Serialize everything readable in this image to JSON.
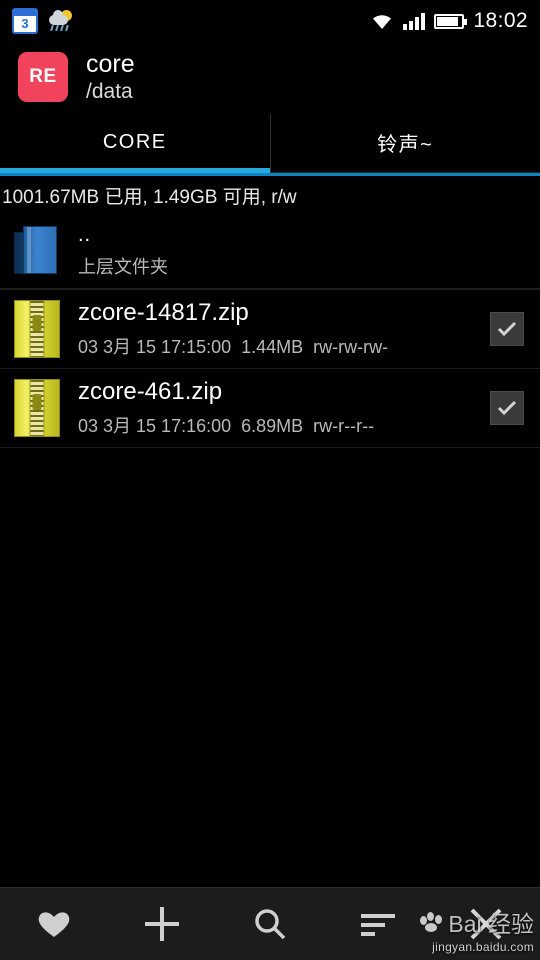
{
  "statusbar": {
    "calendar_day": "3",
    "clock": "18:02",
    "icons": {
      "calendar": "calendar-icon",
      "weather": "weather-partly-cloudy-rain-icon",
      "wifi": "wifi-icon",
      "signal": "cellular-signal-icon",
      "battery": "battery-icon"
    }
  },
  "appbar": {
    "icon_label": "RE",
    "title": "core",
    "path": "/data"
  },
  "tabs": [
    {
      "label": "CORE",
      "active": true
    },
    {
      "label": "铃声~",
      "active": false
    }
  ],
  "storage": {
    "text": "1001.67MB 已用, 1.49GB 可用, r/w"
  },
  "files": [
    {
      "name": "..",
      "sub": "上层文件夹",
      "icon": "folder-up-icon",
      "checkbox": false,
      "checked": false
    },
    {
      "name": "zcore-14817.zip",
      "date": "03 3月 15 17:15:00",
      "size": "1.44MB",
      "perms": "rw-rw-rw-",
      "icon": "zip-file-icon",
      "checkbox": true,
      "checked": true
    },
    {
      "name": "zcore-461.zip",
      "date": "03 3月 15 17:16:00",
      "size": "6.89MB",
      "perms": "rw-r--r--",
      "icon": "zip-file-icon",
      "checkbox": true,
      "checked": true
    }
  ],
  "bottombar": [
    {
      "name": "favorites-button",
      "icon": "heart-icon"
    },
    {
      "name": "add-button",
      "icon": "plus-icon"
    },
    {
      "name": "search-button",
      "icon": "search-icon"
    },
    {
      "name": "sort-button",
      "icon": "sort-lines-icon"
    },
    {
      "name": "close-button",
      "icon": "close-x-icon"
    }
  ],
  "watermark": {
    "text": "Bai 经验",
    "sub": "jingyan.baidu.com"
  },
  "colors": {
    "accent": "#2aa9e0",
    "app_icon": "#f1435c",
    "zip": "#e4e13b",
    "folder": "#3c86cf"
  }
}
